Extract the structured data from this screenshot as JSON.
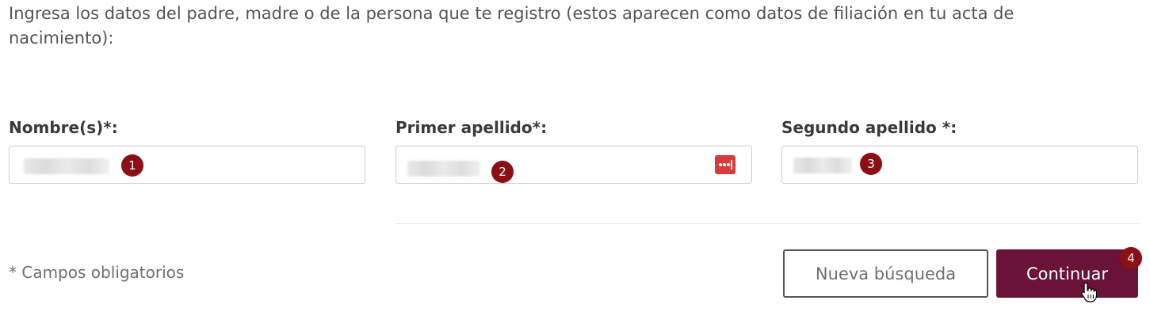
{
  "intro_text": "Ingresa los datos del padre, madre o de la persona que te registro (estos aparecen como datos de filiación en tu acta de nacimiento):",
  "fields": [
    {
      "label": "Nombre(s)*:",
      "marker": "1"
    },
    {
      "label": "Primer apellido*:",
      "marker": "2"
    },
    {
      "label": "Segundo apellido *:",
      "marker": "3"
    }
  ],
  "required_note": "* Campos obligatorios",
  "buttons": {
    "new_search": "Nueva búsqueda",
    "continue": "Continuar",
    "continue_marker": "4"
  },
  "icons": {
    "password_manager": "password-manager-icon",
    "cursor": "hand-pointer-icon"
  },
  "colors": {
    "primary": "#6a1237",
    "marker": "#8b0f14",
    "password_icon": "#d93a3a"
  }
}
